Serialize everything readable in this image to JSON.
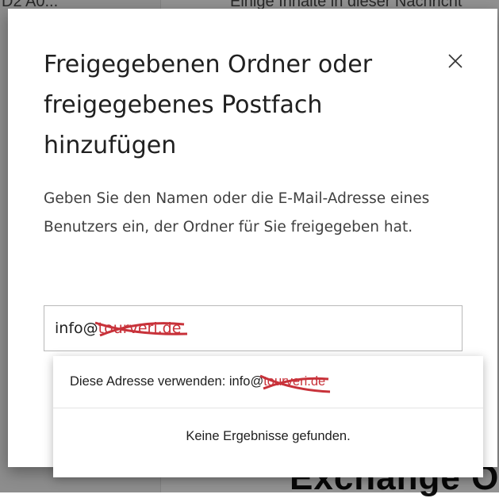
{
  "background": {
    "top_left_text": "D2 A0...",
    "top_right_text": "Einige Inhalte in dieser Nachricht",
    "bottom_right_text": "Exchange O"
  },
  "dialog": {
    "title": "Freigegebenen Ordner oder freigegebenes Postfach hinzufügen",
    "description": "Geben Sie den Namen oder die E-Mail-Adresse eines Benutzers ein, der Ordner für Sie freigegeben hat.",
    "input": {
      "value_prefix": "info@",
      "value_redacted": "tourveri.de"
    },
    "suggestion": {
      "use_address_label": "Diese Adresse verwenden: info@",
      "use_address_redacted": "tourveri.de",
      "no_results": "Keine Ergebnisse gefunden."
    }
  },
  "icons": {
    "close": "close-icon"
  },
  "colors": {
    "redaction": "#c8323a",
    "overlay": "rgba(0,0,0,0.42)"
  }
}
